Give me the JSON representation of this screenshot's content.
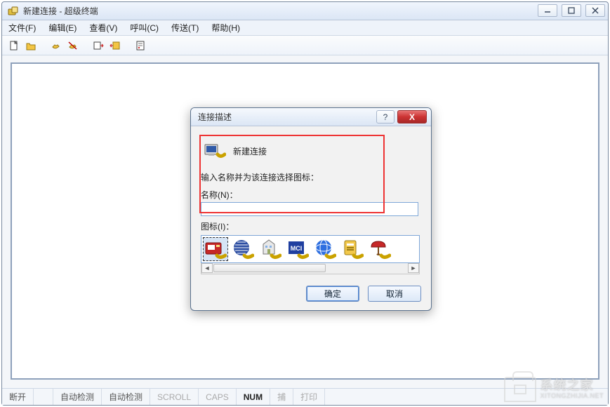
{
  "window": {
    "title": "新建连接 - 超级终端"
  },
  "menu": {
    "file": "文件(F)",
    "edit": "编辑(E)",
    "view": "查看(V)",
    "call": "呼叫(C)",
    "transfer": "传送(T)",
    "help": "帮助(H)"
  },
  "toolbar_icons": {
    "new": "new-file-icon",
    "open": "open-folder-icon",
    "connect": "phone-connect-icon",
    "disconnect": "phone-disconnect-icon",
    "send": "send-icon",
    "receive": "receive-icon",
    "properties": "properties-icon"
  },
  "dialog": {
    "title": "连接描述",
    "heading": "新建连接",
    "instruction": "输入名称并为该连接选择图标：",
    "name_label": "名称(N)：",
    "name_value": "",
    "icon_label": "图标(I)：",
    "icons": [
      "red-phone-modem",
      "globe-bars",
      "building-phone",
      "mci-block",
      "att-globe",
      "clipboard-phone",
      "red-umbrella-phone"
    ],
    "selected_icon_index": 0,
    "ok": "确定",
    "cancel": "取消",
    "help_btn": "?",
    "close_btn": "X"
  },
  "status": {
    "connection": "断开",
    "detect1": "自动检测",
    "detect2": "自动检测",
    "scroll": "SCROLL",
    "caps": "CAPS",
    "num": "NUM",
    "capture": "捕",
    "print": "打印"
  },
  "watermark": {
    "cn": "系统之家",
    "en": "XITONGZHIJIA.NET"
  }
}
